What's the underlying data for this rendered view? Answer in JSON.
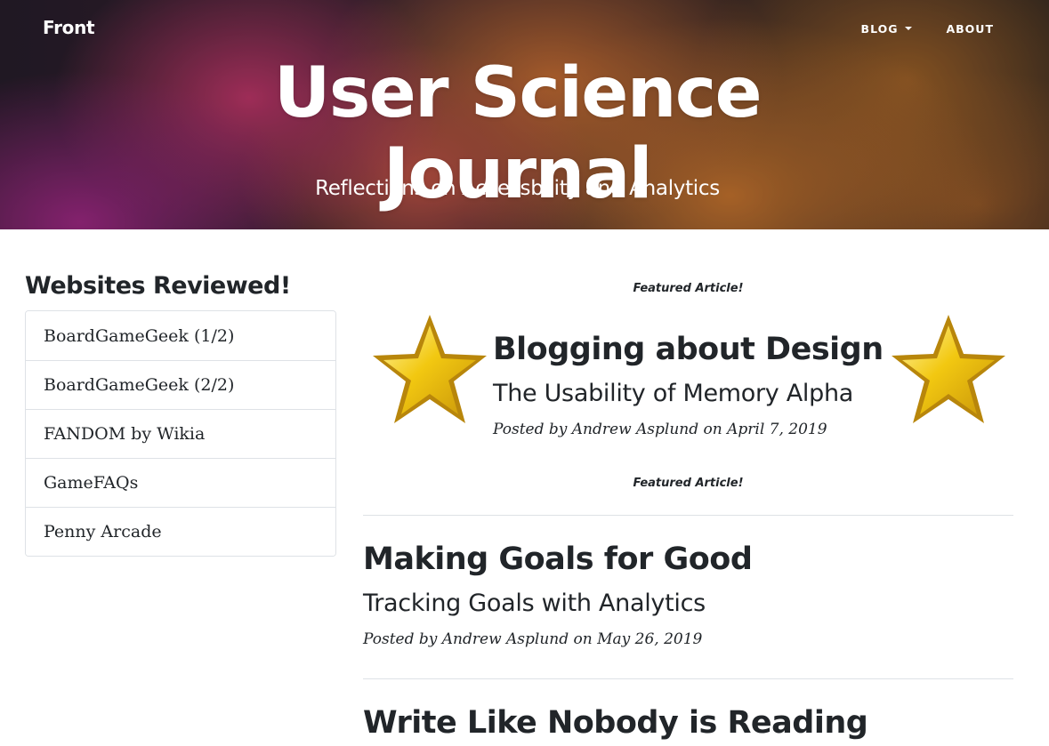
{
  "header": {
    "brand": "Front",
    "title": "User Science Journal",
    "subtitle": "Reflections on Accessbility and Analytics",
    "nav": [
      {
        "label": "BLOG",
        "has_dropdown": true
      },
      {
        "label": "ABOUT",
        "has_dropdown": false
      }
    ]
  },
  "sidebar": {
    "heading": "Websites Reviewed!",
    "items": [
      {
        "label": "BoardGameGeek (1/2)"
      },
      {
        "label": "BoardGameGeek (2/2)"
      },
      {
        "label": "FANDOM by Wikia"
      },
      {
        "label": "GameFAQs"
      },
      {
        "label": "Penny Arcade"
      }
    ]
  },
  "featured": {
    "label_top": "Featured Article!",
    "label_bottom": "Featured Article!",
    "title": "Blogging about Design",
    "subtitle": "The Usability of Memory Alpha",
    "meta": "Posted by Andrew Asplund on April 7, 2019",
    "star_icon": "star-icon"
  },
  "posts": [
    {
      "title": "Making Goals for Good",
      "subtitle": "Tracking Goals with Analytics",
      "meta": "Posted by Andrew Asplund on May 26, 2019"
    },
    {
      "title": "Write Like Nobody is Reading"
    }
  ],
  "colors": {
    "text": "#212529",
    "divider": "#dee2e6",
    "star_gold": "#f2c811",
    "star_edge": "#b8860b"
  }
}
